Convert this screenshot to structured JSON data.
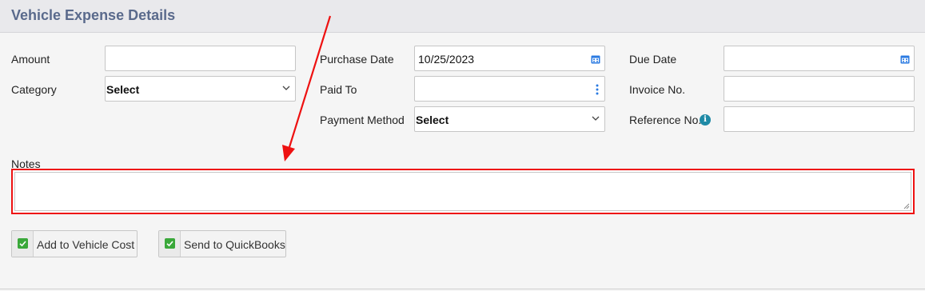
{
  "header": {
    "title": "Vehicle Expense Details"
  },
  "fields": {
    "amount": {
      "label": "Amount",
      "value": ""
    },
    "category": {
      "label": "Category",
      "selected": "Select"
    },
    "purchase_date": {
      "label": "Purchase Date",
      "value": "10/25/2023"
    },
    "paid_to": {
      "label": "Paid To",
      "value": ""
    },
    "payment_method": {
      "label": "Payment Method",
      "selected": "Select"
    },
    "due_date": {
      "label": "Due Date",
      "value": ""
    },
    "invoice_no": {
      "label": "Invoice No.",
      "value": ""
    },
    "reference_no": {
      "label": "Reference No.",
      "value": ""
    },
    "notes": {
      "label": "Notes",
      "value": ""
    }
  },
  "checkboxes": [
    {
      "label": "Add to Vehicle Cost",
      "checked": true
    },
    {
      "label": "Send to QuickBooks",
      "checked": true
    }
  ],
  "colors": {
    "accent_header": "#5a6a8c",
    "highlight": "#ee1111",
    "checkbox": "#3aa83a",
    "icon_blue": "#2a7ae2",
    "info": "#1f8aa6"
  },
  "icons": [
    "calendar-icon",
    "more-vertical-icon",
    "chevron-down-icon",
    "info-icon",
    "check-icon",
    "resize-grip-icon"
  ]
}
